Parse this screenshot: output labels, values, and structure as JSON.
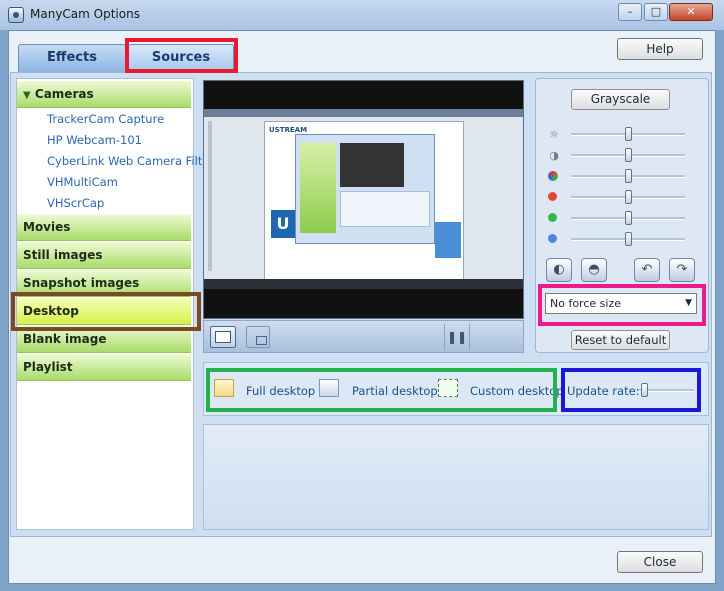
{
  "window": {
    "title": "ManyCam Options",
    "minimize": "–",
    "maximize": "□",
    "close": "✕"
  },
  "tabs": [
    {
      "label": "Effects"
    },
    {
      "label": "Sources"
    }
  ],
  "help_label": "Help",
  "sidebar": {
    "cameras_label": "Cameras",
    "cameras": [
      "TrackerCam Capture",
      "HP Webcam-101",
      "CyberLink Web Camera Filter",
      "VHMultiCam",
      "VHScrCap"
    ],
    "categories": [
      "Movies",
      "Still images",
      "Snapshot images",
      "Desktop",
      "Blank image",
      "Playlist"
    ],
    "selected": "Desktop"
  },
  "controls": {
    "grayscale_label": "Grayscale",
    "slider_icons": [
      "sun-icon",
      "contrast-icon",
      "color-icon",
      "red-icon",
      "green-icon",
      "blue-icon"
    ],
    "slider_levels": [
      0.5,
      0.5,
      0.5,
      0.5,
      0.5,
      0.5
    ],
    "force_size": "No force size",
    "reset_label": "Reset to default"
  },
  "desktop_options": {
    "full": "Full desktop",
    "partial": "Partial desktop",
    "custom": "Custom desktop",
    "update_rate_label": "Update rate:",
    "update_rate_level": 0.05
  },
  "close_label": "Close",
  "colors": {
    "highlight_red": "#e8192c",
    "highlight_brown": "#7b4a1e",
    "highlight_magenta": "#ea1c8c",
    "highlight_green": "#23b14c",
    "highlight_blue": "#1a1ad6",
    "preview_logo": "USTREAM"
  }
}
